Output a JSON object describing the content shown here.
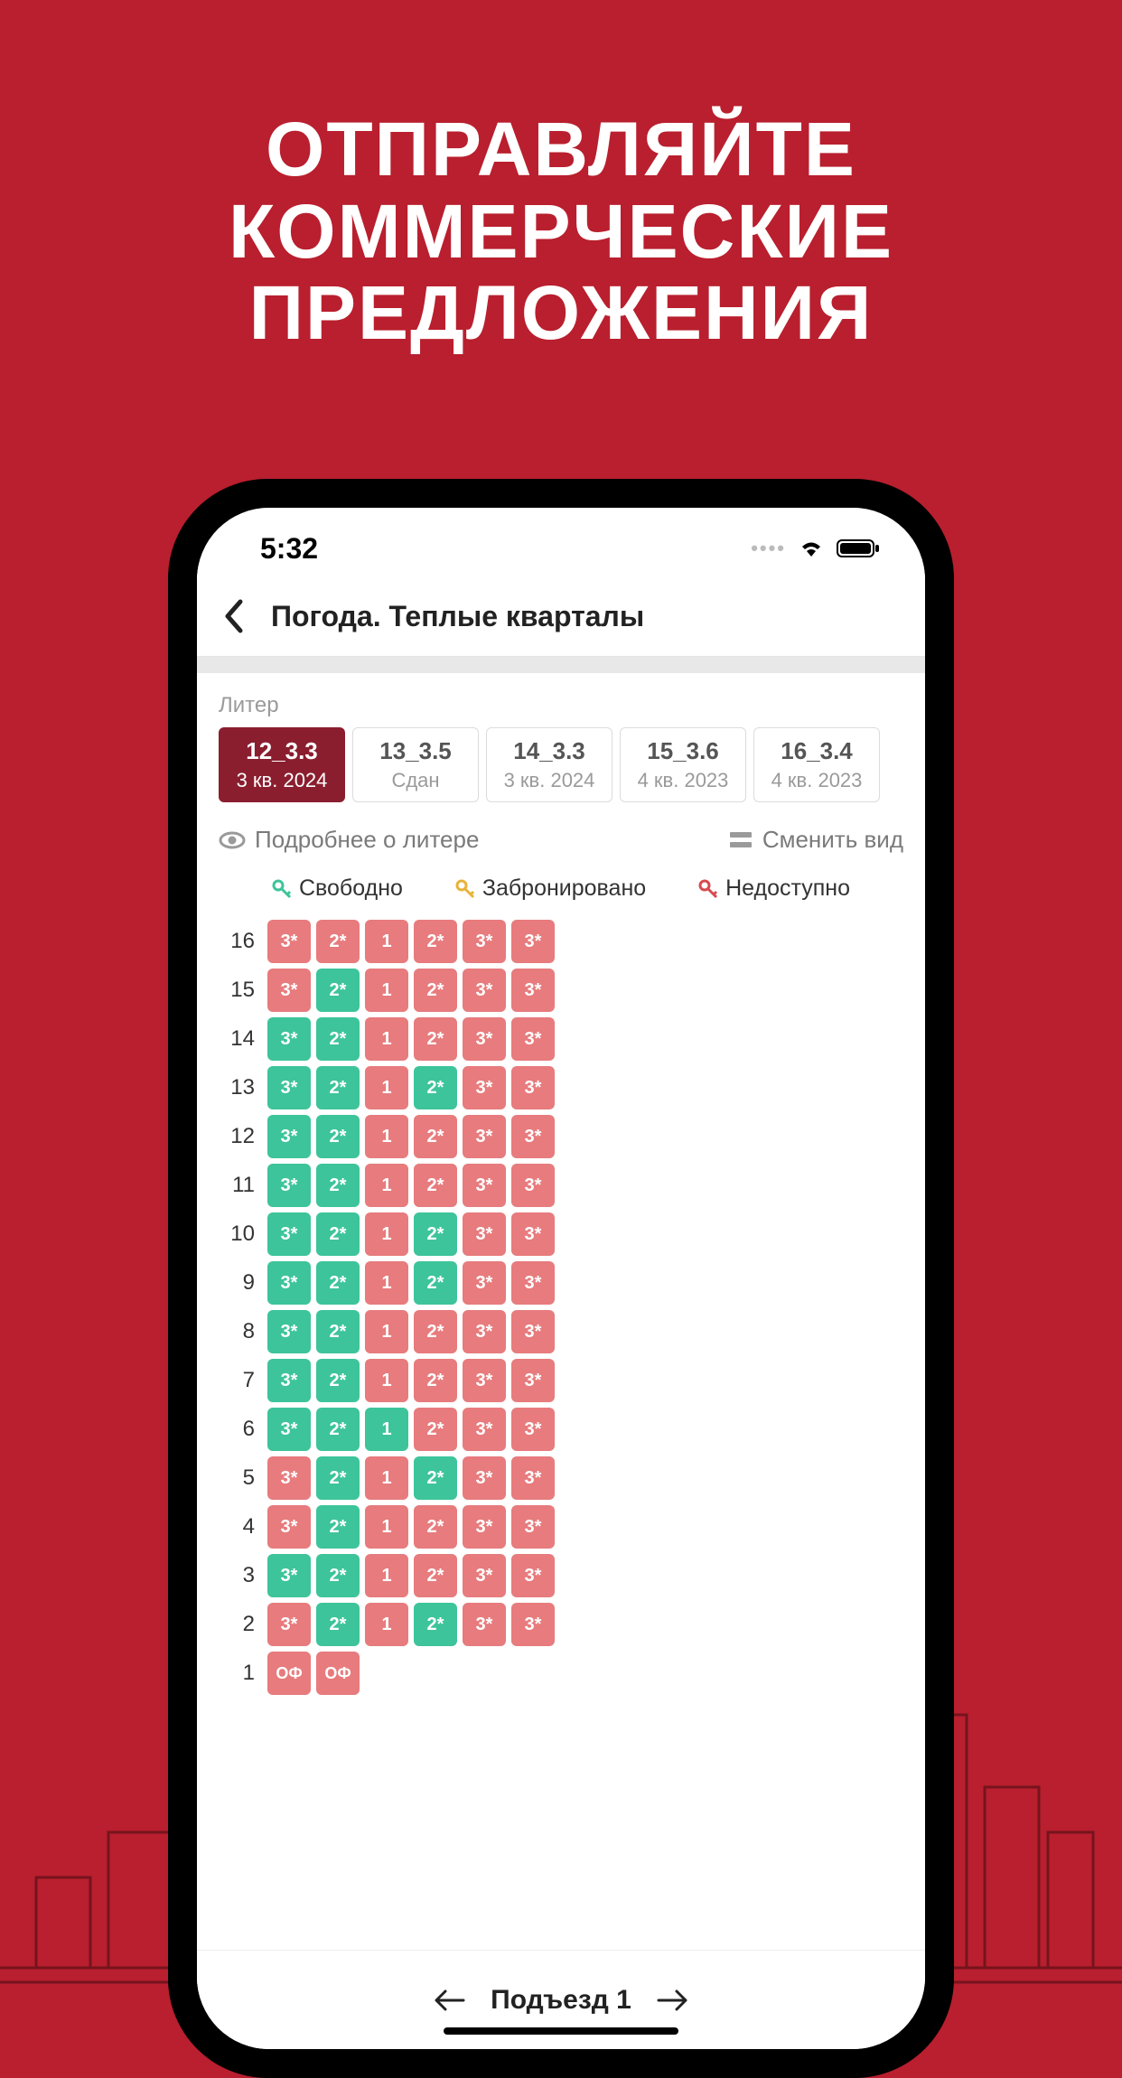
{
  "promo": {
    "line1": "ОТПРАВЛЯЙТЕ",
    "line2": "КОММЕРЧЕСКИЕ",
    "line3": "ПРЕДЛОЖЕНИЯ"
  },
  "status": {
    "time": "5:32"
  },
  "nav": {
    "title": "Погода. Теплые кварталы"
  },
  "section_label": "Литер",
  "tabs": [
    {
      "id": "12_3.3",
      "sub": "3 кв. 2024",
      "active": true
    },
    {
      "id": "13_3.5",
      "sub": "Сдан",
      "active": false
    },
    {
      "id": "14_3.3",
      "sub": "3 кв. 2024",
      "active": false
    },
    {
      "id": "15_3.6",
      "sub": "4 кв. 2023",
      "active": false
    },
    {
      "id": "16_3.4",
      "sub": "4 кв. 2023",
      "active": false
    }
  ],
  "toolbar": {
    "details": "Подробнее о литере",
    "switch_view": "Сменить вид"
  },
  "legend": {
    "free": "Свободно",
    "reserved": "Забронировано",
    "unavailable": "Недоступно"
  },
  "legend_colors": {
    "free": "#3dc49a",
    "reserved": "#e8b23b",
    "unavailable": "#d74a4f"
  },
  "floors": [
    {
      "n": 16,
      "cells": [
        {
          "t": "3*",
          "s": "r"
        },
        {
          "t": "2*",
          "s": "r"
        },
        {
          "t": "1",
          "s": "r"
        },
        {
          "t": "2*",
          "s": "r"
        },
        {
          "t": "3*",
          "s": "r"
        },
        {
          "t": "3*",
          "s": "r"
        }
      ]
    },
    {
      "n": 15,
      "cells": [
        {
          "t": "3*",
          "s": "r"
        },
        {
          "t": "2*",
          "s": "g"
        },
        {
          "t": "1",
          "s": "r"
        },
        {
          "t": "2*",
          "s": "r"
        },
        {
          "t": "3*",
          "s": "r"
        },
        {
          "t": "3*",
          "s": "r"
        }
      ]
    },
    {
      "n": 14,
      "cells": [
        {
          "t": "3*",
          "s": "g"
        },
        {
          "t": "2*",
          "s": "g"
        },
        {
          "t": "1",
          "s": "r"
        },
        {
          "t": "2*",
          "s": "r"
        },
        {
          "t": "3*",
          "s": "r"
        },
        {
          "t": "3*",
          "s": "r"
        }
      ]
    },
    {
      "n": 13,
      "cells": [
        {
          "t": "3*",
          "s": "g"
        },
        {
          "t": "2*",
          "s": "g"
        },
        {
          "t": "1",
          "s": "r"
        },
        {
          "t": "2*",
          "s": "g"
        },
        {
          "t": "3*",
          "s": "r"
        },
        {
          "t": "3*",
          "s": "r"
        }
      ]
    },
    {
      "n": 12,
      "cells": [
        {
          "t": "3*",
          "s": "g"
        },
        {
          "t": "2*",
          "s": "g"
        },
        {
          "t": "1",
          "s": "r"
        },
        {
          "t": "2*",
          "s": "r"
        },
        {
          "t": "3*",
          "s": "r"
        },
        {
          "t": "3*",
          "s": "r"
        }
      ]
    },
    {
      "n": 11,
      "cells": [
        {
          "t": "3*",
          "s": "g"
        },
        {
          "t": "2*",
          "s": "g"
        },
        {
          "t": "1",
          "s": "r"
        },
        {
          "t": "2*",
          "s": "r"
        },
        {
          "t": "3*",
          "s": "r"
        },
        {
          "t": "3*",
          "s": "r"
        }
      ]
    },
    {
      "n": 10,
      "cells": [
        {
          "t": "3*",
          "s": "g"
        },
        {
          "t": "2*",
          "s": "g"
        },
        {
          "t": "1",
          "s": "r"
        },
        {
          "t": "2*",
          "s": "g"
        },
        {
          "t": "3*",
          "s": "r"
        },
        {
          "t": "3*",
          "s": "r"
        }
      ]
    },
    {
      "n": 9,
      "cells": [
        {
          "t": "3*",
          "s": "g"
        },
        {
          "t": "2*",
          "s": "g"
        },
        {
          "t": "1",
          "s": "r"
        },
        {
          "t": "2*",
          "s": "g"
        },
        {
          "t": "3*",
          "s": "r"
        },
        {
          "t": "3*",
          "s": "r"
        }
      ]
    },
    {
      "n": 8,
      "cells": [
        {
          "t": "3*",
          "s": "g"
        },
        {
          "t": "2*",
          "s": "g"
        },
        {
          "t": "1",
          "s": "r"
        },
        {
          "t": "2*",
          "s": "r"
        },
        {
          "t": "3*",
          "s": "r"
        },
        {
          "t": "3*",
          "s": "r"
        }
      ]
    },
    {
      "n": 7,
      "cells": [
        {
          "t": "3*",
          "s": "g"
        },
        {
          "t": "2*",
          "s": "g"
        },
        {
          "t": "1",
          "s": "r"
        },
        {
          "t": "2*",
          "s": "r"
        },
        {
          "t": "3*",
          "s": "r"
        },
        {
          "t": "3*",
          "s": "r"
        }
      ]
    },
    {
      "n": 6,
      "cells": [
        {
          "t": "3*",
          "s": "g"
        },
        {
          "t": "2*",
          "s": "g"
        },
        {
          "t": "1",
          "s": "g"
        },
        {
          "t": "2*",
          "s": "r"
        },
        {
          "t": "3*",
          "s": "r"
        },
        {
          "t": "3*",
          "s": "r"
        }
      ]
    },
    {
      "n": 5,
      "cells": [
        {
          "t": "3*",
          "s": "r"
        },
        {
          "t": "2*",
          "s": "g"
        },
        {
          "t": "1",
          "s": "r"
        },
        {
          "t": "2*",
          "s": "g"
        },
        {
          "t": "3*",
          "s": "r"
        },
        {
          "t": "3*",
          "s": "r"
        }
      ]
    },
    {
      "n": 4,
      "cells": [
        {
          "t": "3*",
          "s": "r"
        },
        {
          "t": "2*",
          "s": "g"
        },
        {
          "t": "1",
          "s": "r"
        },
        {
          "t": "2*",
          "s": "r"
        },
        {
          "t": "3*",
          "s": "r"
        },
        {
          "t": "3*",
          "s": "r"
        }
      ]
    },
    {
      "n": 3,
      "cells": [
        {
          "t": "3*",
          "s": "g"
        },
        {
          "t": "2*",
          "s": "g"
        },
        {
          "t": "1",
          "s": "r"
        },
        {
          "t": "2*",
          "s": "r"
        },
        {
          "t": "3*",
          "s": "r"
        },
        {
          "t": "3*",
          "s": "r"
        }
      ]
    },
    {
      "n": 2,
      "cells": [
        {
          "t": "3*",
          "s": "r"
        },
        {
          "t": "2*",
          "s": "g"
        },
        {
          "t": "1",
          "s": "r"
        },
        {
          "t": "2*",
          "s": "g"
        },
        {
          "t": "3*",
          "s": "r"
        },
        {
          "t": "3*",
          "s": "r"
        }
      ]
    },
    {
      "n": 1,
      "cells": [
        {
          "t": "ОФ",
          "s": "of"
        },
        {
          "t": "ОФ",
          "s": "of"
        }
      ]
    }
  ],
  "pager": {
    "label": "Подъезд 1"
  }
}
